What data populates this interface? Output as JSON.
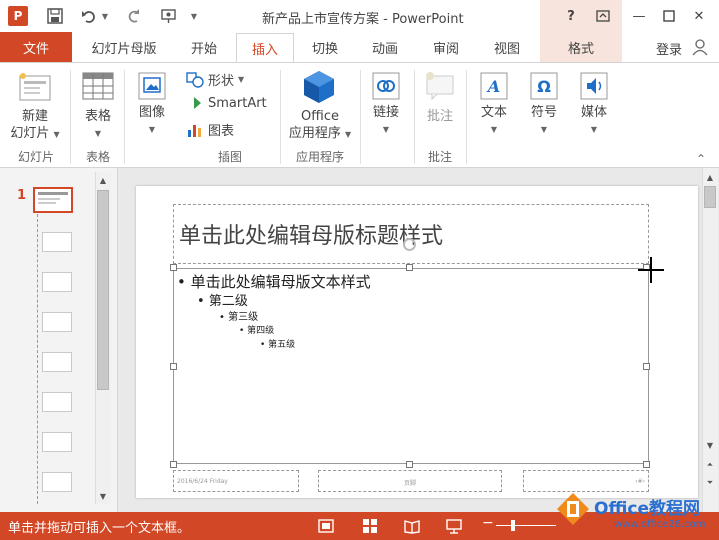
{
  "window": {
    "app_badge": "P",
    "title": "新产品上市宣传方案 - PowerPoint",
    "help": "?",
    "minimize": "—",
    "close": "✕"
  },
  "tabs": {
    "file": "文件",
    "slide_master": "幻灯片母版",
    "home": "开始",
    "insert": "插入",
    "transitions": "切换",
    "animations": "动画",
    "review": "审阅",
    "view": "视图",
    "format": "格式",
    "login": "登录"
  },
  "ribbon": {
    "new_slide_line1": "新建",
    "new_slide_line2": "幻灯片",
    "table": "表格",
    "images": "图像",
    "shapes": "形状",
    "smartart": "SmartArt",
    "chart": "图表",
    "office_line1": "Office",
    "office_line2": "应用程序",
    "links": "链接",
    "comment": "批注",
    "text": "文本",
    "symbols": "符号",
    "media": "媒体",
    "groups": {
      "slides": "幻灯片",
      "tables": "表格",
      "illustrations": "插图",
      "apps": "应用程序",
      "comments": "批注"
    }
  },
  "thumbnails": {
    "master_number": "1"
  },
  "slide": {
    "title_placeholder": "单击此处编辑母版标题样式",
    "level1": "单击此处编辑母版文本样式",
    "level2": "第二级",
    "level3": "第三级",
    "level4": "第四级",
    "level5": "第五级",
    "footer_date": "2016/6/24 Friday",
    "footer_center": "页脚",
    "footer_number": "‹#›"
  },
  "statusbar": {
    "message": "单击并拖动可插入一个文本框。",
    "zoom_minus": "−"
  },
  "watermark": {
    "brand": "Office教程网",
    "url": "www.office26.com"
  },
  "colors": {
    "accent": "#d24726",
    "context_tab": "#f7e4dc"
  }
}
